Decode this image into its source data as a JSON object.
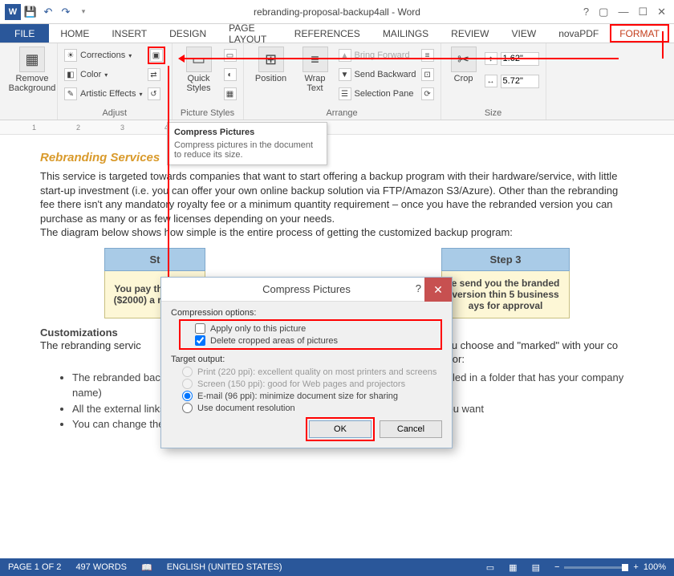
{
  "app": {
    "title_doc": "rebranding-proposal-backup4all - Word"
  },
  "tabs": {
    "file": "FILE",
    "home": "HOME",
    "insert": "INSERT",
    "design": "DESIGN",
    "pagelayout": "PAGE LAYOUT",
    "references": "REFERENCES",
    "mailings": "MAILINGS",
    "review": "REVIEW",
    "view": "VIEW",
    "novapdf": "novaPDF",
    "format": "FORMAT"
  },
  "ribbon": {
    "remove_bg": "Remove Background",
    "corrections": "Corrections",
    "color": "Color",
    "artistic": "Artistic Effects",
    "adjust": "Adjust",
    "quick_styles": "Quick Styles",
    "picture_styles": "Picture Styles",
    "position": "Position",
    "wrap_text": "Wrap Text",
    "bring_forward": "Bring Forward",
    "send_backward": "Send Backward",
    "selection_pane": "Selection Pane",
    "arrange": "Arrange",
    "crop": "Crop",
    "size": "Size",
    "height_val": "1.62\"",
    "width_val": "5.72\""
  },
  "tooltip": {
    "title": "Compress Pictures",
    "body": "Compress pictures in the document to reduce its size."
  },
  "doc": {
    "h1": "Rebranding Services",
    "p1": "This service is targeted towards companies that want to start offering a backup program with their hardware/service, with little start-up investment (i.e. you can offer your own online backup solution via FTP/Amazon S3/Azure). Other than the rebranding fee there isn't any mandatory royalty fee or a minimum quantity requirement – once you have the rebranded version you can purchase as many or as few licenses depending on your needs.",
    "p2": "The diagram below shows how simple is the entire process of getting the customized backup program:",
    "step1_h": "St",
    "step3_h": "Step 3",
    "step1_c": "You pay th rebran ($2000) a rebrandi",
    "step3_c": "e send you the branded version thin 5 business ays for approval",
    "h2": "Customizations",
    "p3a": "The rebranding servic",
    "p3b": "name you choose and \"marked\" with your co",
    "p3c": "e customizations that you can opt for:",
    "li1": "The rebranded backup program will have a name chosen by you (and will be installed in a folder that has your company name)",
    "li2": "All the external links (emails, buy/register/read more) will point to whatever links you want",
    "li3": "You can change the installer logo/name and the splash installer"
  },
  "dialog": {
    "title": "Compress Pictures",
    "comp_header": "Compression options:",
    "apply_only": "Apply only to this picture",
    "delete_cropped": "Delete cropped areas of pictures",
    "target_header": "Target output:",
    "print": "Print (220 ppi): excellent quality on most printers and screens",
    "screen": "Screen (150 ppi): good for Web pages and projectors",
    "email": "E-mail (96 ppi): minimize document size for sharing",
    "docres": "Use document resolution",
    "ok": "OK",
    "cancel": "Cancel",
    "apply_only_checked": false,
    "delete_cropped_checked": true
  },
  "status": {
    "page": "PAGE 1 OF 2",
    "words": "497 WORDS",
    "lang": "ENGLISH (UNITED STATES)",
    "zoom": "100%"
  }
}
